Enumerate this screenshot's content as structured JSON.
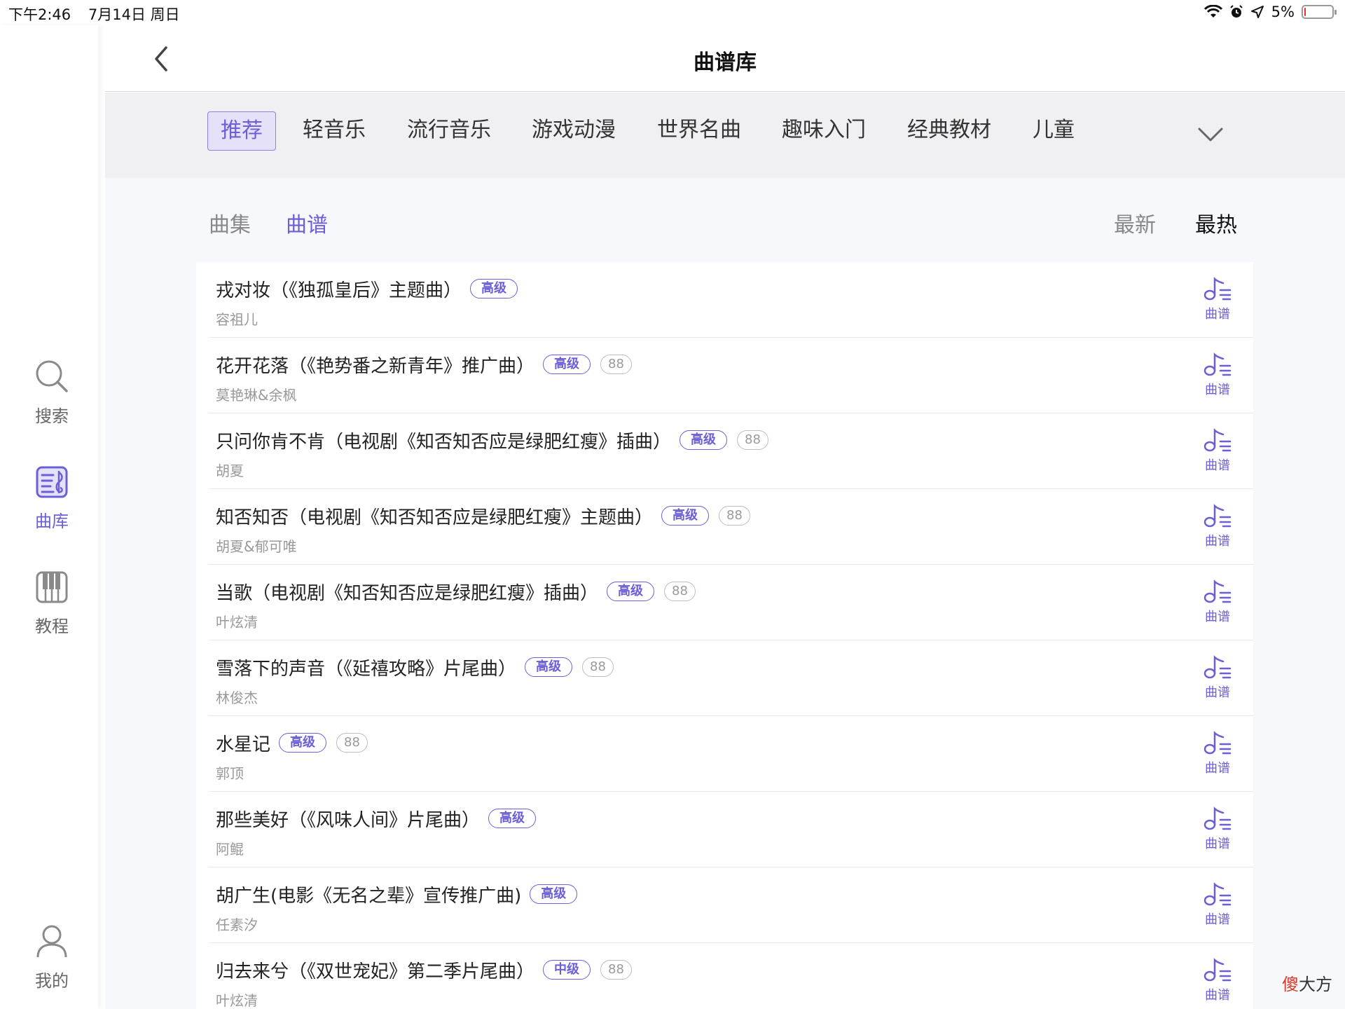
{
  "status_bar": {
    "time": "下午2:46",
    "date": "7月14日 周日",
    "battery_percent": "5%",
    "battery_level": 0.05
  },
  "sidebar": {
    "items": [
      {
        "label": "搜索",
        "icon": "search-icon"
      },
      {
        "label": "曲库",
        "icon": "score-library-icon",
        "active": true
      },
      {
        "label": "教程",
        "icon": "piano-icon"
      },
      {
        "label": "我的",
        "icon": "user-icon"
      }
    ]
  },
  "header": {
    "title": "曲谱库",
    "back_icon": "chevron-left-icon"
  },
  "categories": {
    "tabs": [
      "推荐",
      "轻音乐",
      "流行音乐",
      "游戏动漫",
      "世界名曲",
      "趣味入门",
      "经典教材",
      "儿童"
    ],
    "active_index": 0,
    "expand_icon": "chevron-down-icon"
  },
  "sub_tabs": {
    "items": [
      "曲集",
      "曲谱"
    ],
    "active_index": 1
  },
  "sort": {
    "items": [
      "最新",
      "最热"
    ],
    "active_index": 1
  },
  "songs": [
    {
      "title": "戎对妆（《独孤皇后》主题曲）",
      "level": "高级",
      "count": "",
      "artist": "容祖儿",
      "action": "曲谱"
    },
    {
      "title": "花开花落（《艳势番之新青年》推广曲）",
      "level": "高级",
      "count": "88",
      "artist": "莫艳琳&余枫",
      "action": "曲谱"
    },
    {
      "title": "只问你肯不肯（电视剧《知否知否应是绿肥红瘦》插曲）",
      "level": "高级",
      "count": "88",
      "artist": "胡夏",
      "action": "曲谱"
    },
    {
      "title": "知否知否（电视剧《知否知否应是绿肥红瘦》主题曲）",
      "level": "高级",
      "count": "88",
      "artist": "胡夏&郁可唯",
      "action": "曲谱"
    },
    {
      "title": "当歌（电视剧《知否知否应是绿肥红瘦》插曲）",
      "level": "高级",
      "count": "88",
      "artist": "叶炫清",
      "action": "曲谱"
    },
    {
      "title": "雪落下的声音（《延禧攻略》片尾曲）",
      "level": "高级",
      "count": "88",
      "artist": "林俊杰",
      "action": "曲谱"
    },
    {
      "title": "水星记",
      "level": "高级",
      "count": "88",
      "artist": "郭顶",
      "action": "曲谱"
    },
    {
      "title": "那些美好（《风味人间》片尾曲）",
      "level": "高级",
      "count": "",
      "artist": "阿鲲",
      "action": "曲谱"
    },
    {
      "title": "胡广生(电影《无名之辈》宣传推广曲)",
      "level": "高级",
      "count": "",
      "artist": "任素汐",
      "action": "曲谱"
    },
    {
      "title": "归去来兮（《双世宠妃》第二季片尾曲）",
      "level": "中级",
      "count": "88",
      "artist": "叶炫清",
      "action": "曲谱"
    }
  ],
  "watermark": {
    "first": "傻",
    "rest": "大方"
  },
  "colors": {
    "accent": "#6b5fd8",
    "accent_bg": "#e5e1f8",
    "category_bar_bg": "#f0f0f2",
    "content_bg": "#f6f8fb",
    "battery_low": "#e0312c"
  }
}
